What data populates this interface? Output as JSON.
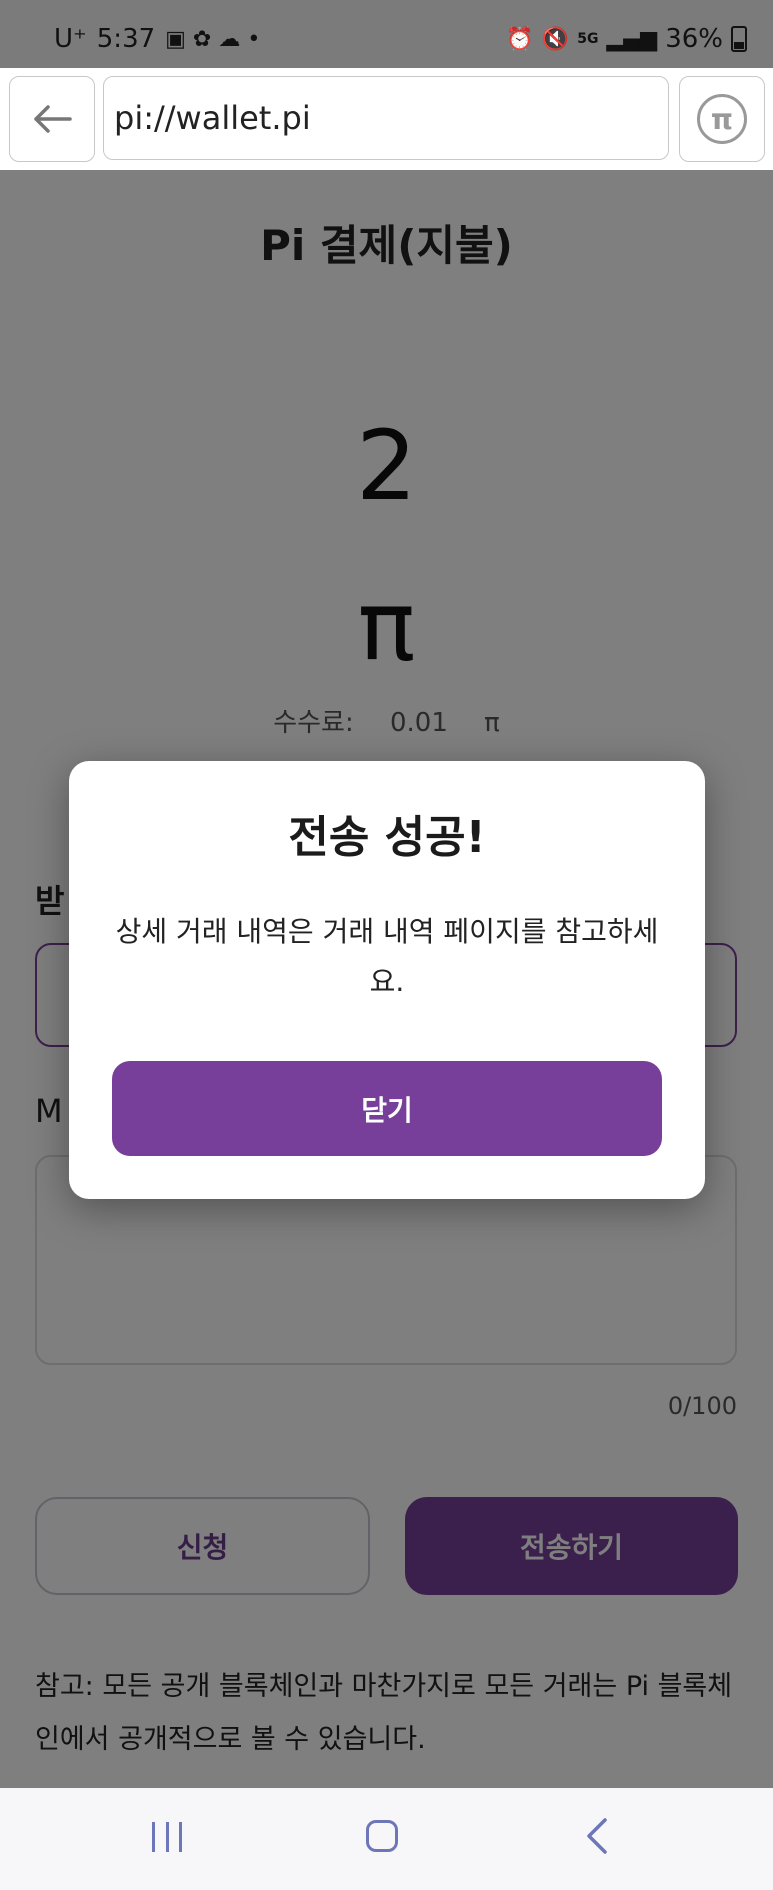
{
  "status_bar": {
    "carrier": "U⁺",
    "time": "5:37",
    "network": "5G",
    "battery": "36%"
  },
  "browser": {
    "url": "pi://wallet.pi",
    "back_icon": "arrow-left-icon",
    "app_icon": "pi-logo-icon",
    "app_icon_glyph": "π"
  },
  "page": {
    "title": "Pi 결제(지불)",
    "amount": "2",
    "currency_symbol": "π",
    "fee_label": "수수료:",
    "fee_value": "0.01",
    "fee_unit": "π",
    "recipient_label": "받",
    "memo_label": "M",
    "memo_counter": "0/100",
    "request_button": "신청",
    "send_button": "전송하기",
    "note": "참고: 모든 공개 블록체인과 마찬가지로 모든 거래는 Pi 블록체인에서 공개적으로 볼 수 있습니다."
  },
  "modal": {
    "title": "전송 성공!",
    "message": "상세 거래 내역은 거래 내역 페이지를 참고하세요.",
    "close_button": "닫기"
  },
  "colors": {
    "primary": "#773f9a",
    "overlay": "rgba(0,0,0,0.5)"
  }
}
